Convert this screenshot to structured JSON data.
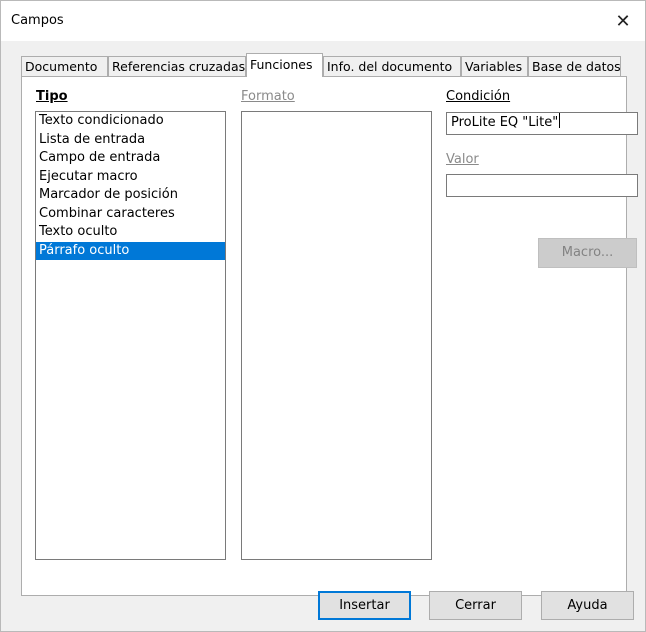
{
  "window": {
    "title": "Campos"
  },
  "tabs": [
    {
      "label": "Documento",
      "active": false
    },
    {
      "label": "Referencias cruzadas",
      "active": false
    },
    {
      "label": "Funciones",
      "active": true
    },
    {
      "label": "Info. del documento",
      "active": false
    },
    {
      "label": "Variables",
      "active": false
    },
    {
      "label": "Base de datos",
      "active": false
    }
  ],
  "tipo": {
    "label": "Tipo",
    "items": [
      "Texto condicionado",
      "Lista de entrada",
      "Campo de entrada",
      "Ejecutar macro",
      "Marcador de posición",
      "Combinar caracteres",
      "Texto oculto",
      "Párrafo oculto"
    ],
    "selected_index": 7
  },
  "formato": {
    "label": "Formato"
  },
  "condicion": {
    "label": "Condición",
    "value": "ProLite EQ \"Lite\""
  },
  "valor": {
    "label": "Valor",
    "value": ""
  },
  "buttons": {
    "macro": "Macro...",
    "insertar": "Insertar",
    "cerrar": "Cerrar",
    "ayuda": "Ayuda"
  }
}
